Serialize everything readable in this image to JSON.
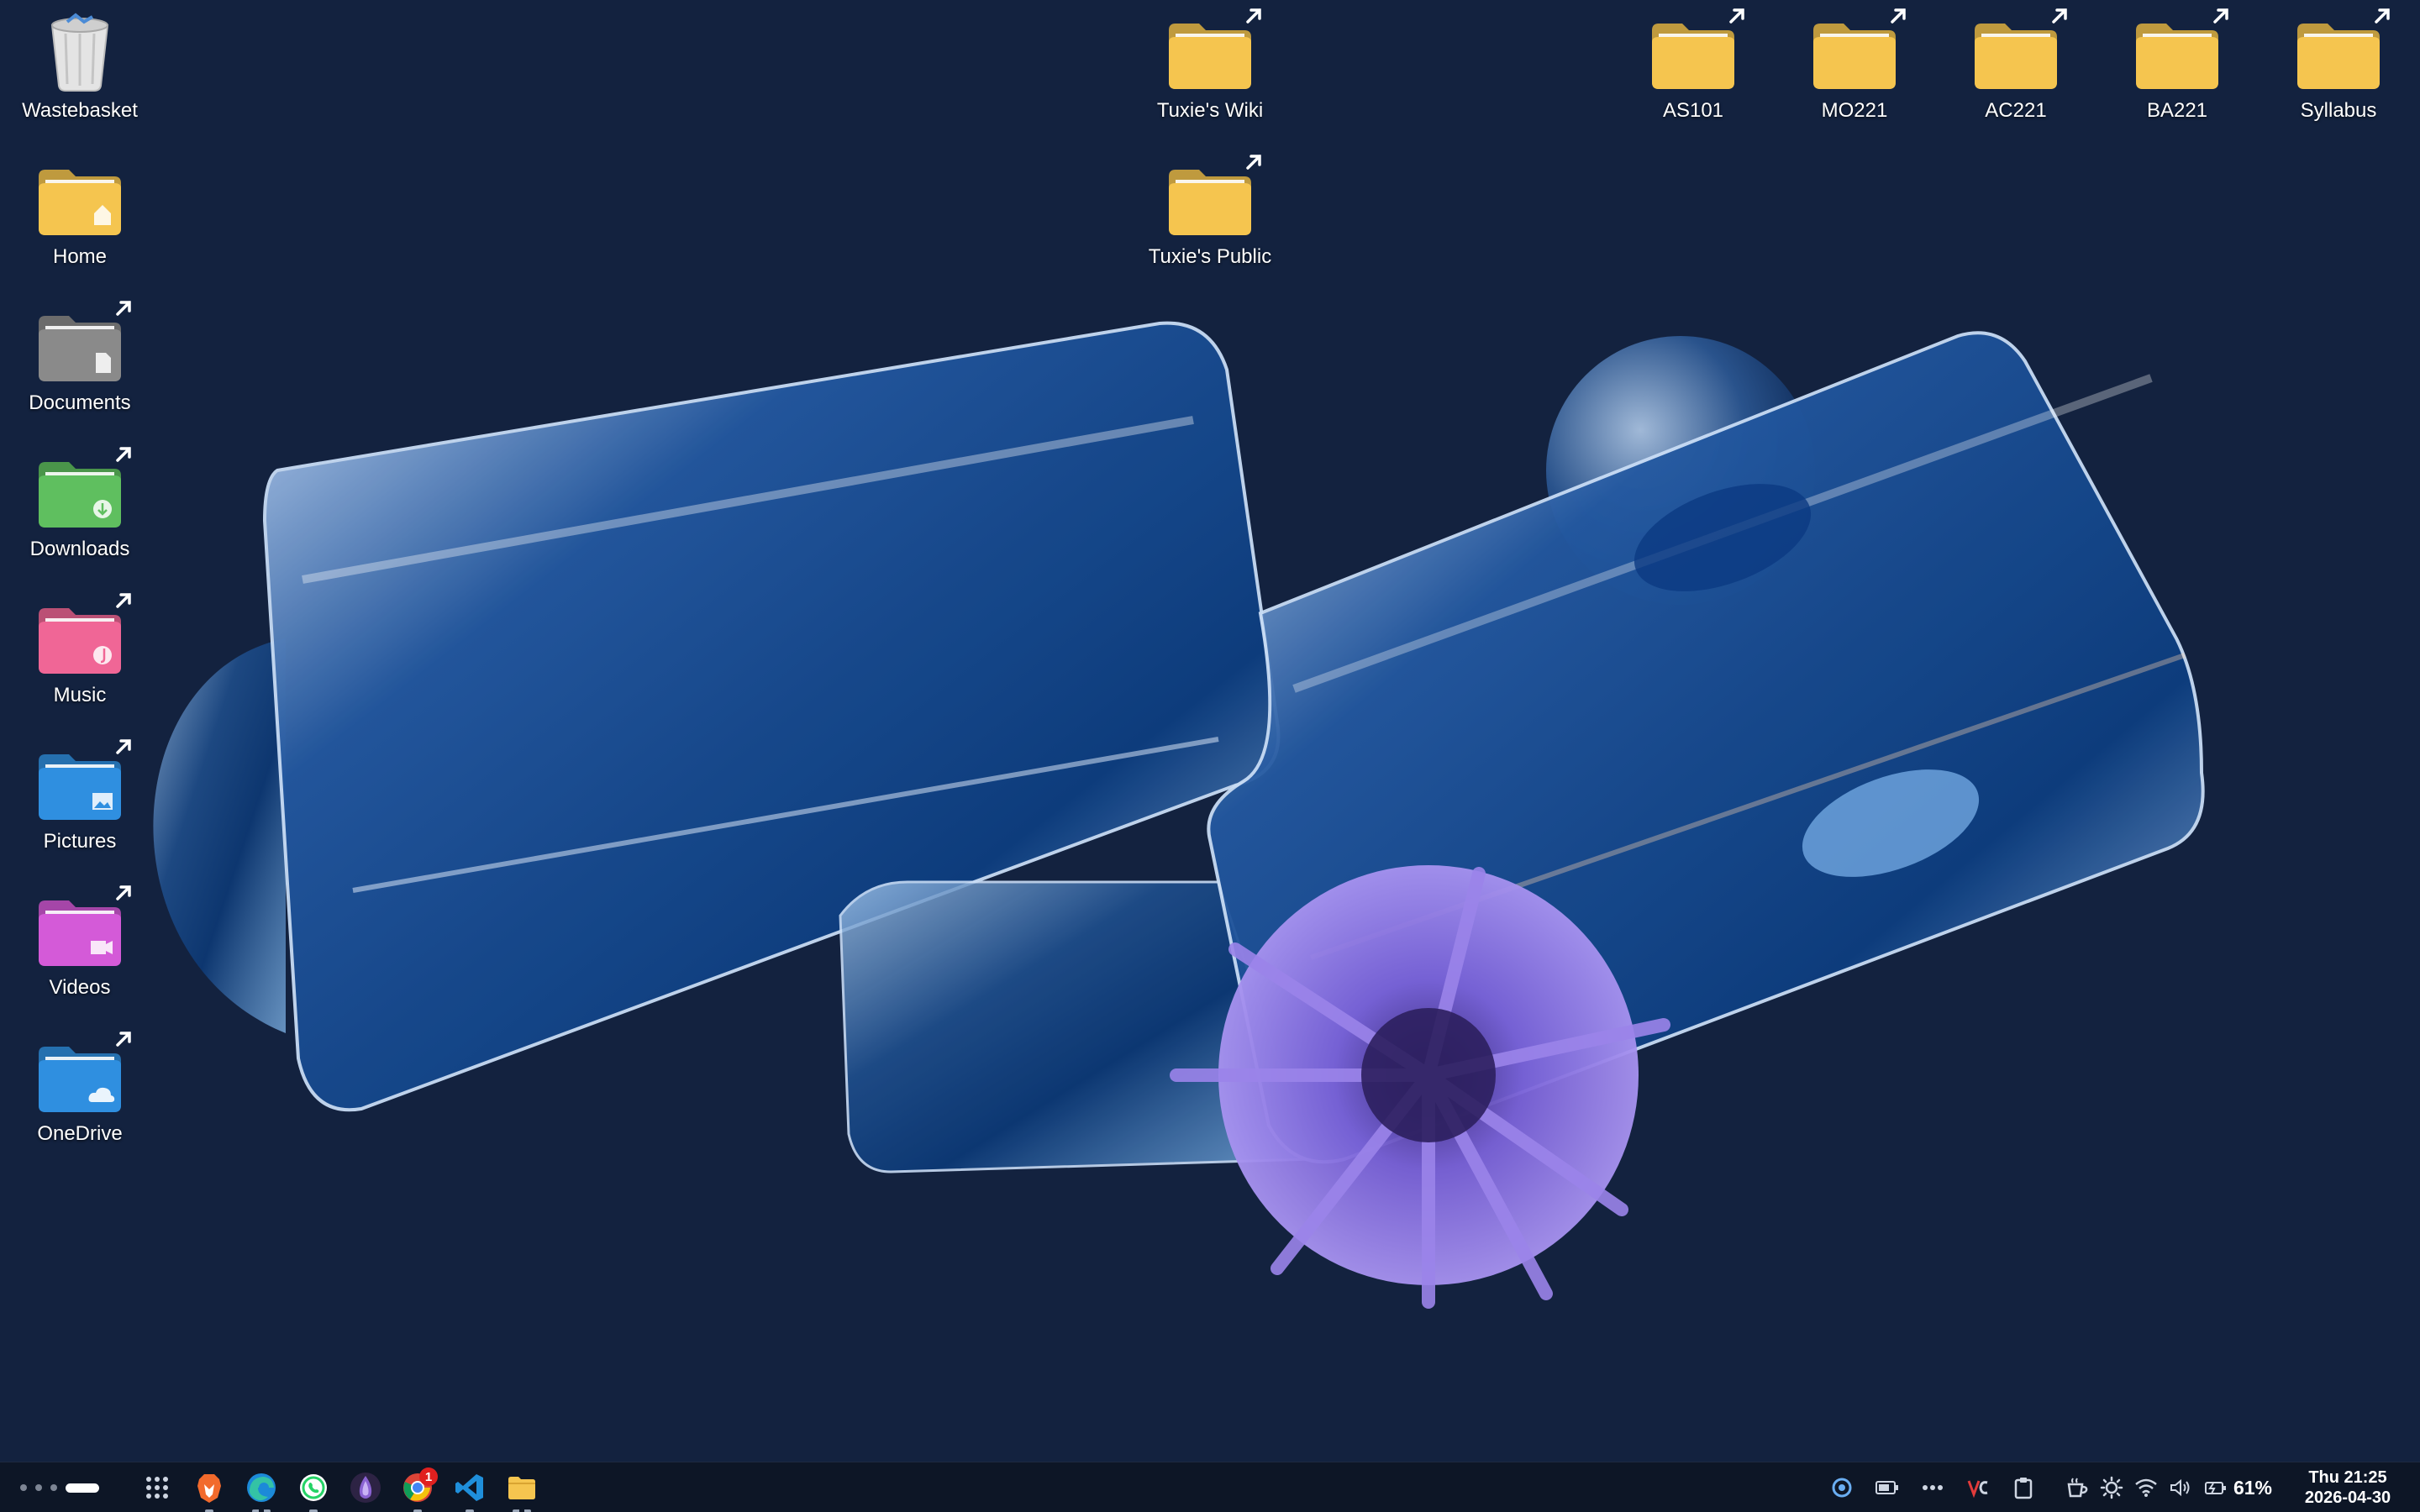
{
  "desktop": {
    "left_column": [
      {
        "label": "Wastebasket",
        "icon": "trash-bin-icon",
        "color": "#d8d8d8",
        "link": false
      },
      {
        "label": "Home",
        "icon": "home-folder-icon",
        "color": "#f5c54f",
        "link": false
      },
      {
        "label": "Documents",
        "icon": "documents-folder-icon",
        "color": "#8a8a8a",
        "link": true
      },
      {
        "label": "Downloads",
        "icon": "downloads-folder-icon",
        "color": "#5fbf5f",
        "link": true
      },
      {
        "label": "Music",
        "icon": "music-folder-icon",
        "color": "#f06696",
        "link": true
      },
      {
        "label": "Pictures",
        "icon": "pictures-folder-icon",
        "color": "#2f8fe0",
        "link": true
      },
      {
        "label": "Videos",
        "icon": "videos-folder-icon",
        "color": "#d45ad8",
        "link": true
      },
      {
        "label": "OneDrive",
        "icon": "onedrive-folder-icon",
        "color": "#2f8fe0",
        "link": true
      }
    ],
    "middle_column": [
      {
        "label": "Tuxie's Wiki",
        "icon": "folder-icon",
        "color": "#f5c54f",
        "link": true
      },
      {
        "label": "Tuxie's Public",
        "icon": "folder-icon",
        "color": "#f5c54f",
        "link": true
      }
    ],
    "top_right_row": [
      {
        "label": "AS101",
        "icon": "folder-icon",
        "color": "#f5c54f",
        "link": true
      },
      {
        "label": "MO221",
        "icon": "folder-icon",
        "color": "#f5c54f",
        "link": true
      },
      {
        "label": "AC221",
        "icon": "folder-icon",
        "color": "#f5c54f",
        "link": true
      },
      {
        "label": "BA221",
        "icon": "folder-icon",
        "color": "#f5c54f",
        "link": true
      },
      {
        "label": "Syllabus",
        "icon": "folder-icon",
        "color": "#f5c54f",
        "link": true
      }
    ]
  },
  "taskbar": {
    "apps": [
      {
        "name": "app-launcher-icon"
      },
      {
        "name": "brave-browser-icon"
      },
      {
        "name": "edge-browser-icon"
      },
      {
        "name": "whatsapp-icon"
      },
      {
        "name": "tor-browser-icon"
      },
      {
        "name": "chrome-browser-icon",
        "badge": "1"
      },
      {
        "name": "vscode-icon"
      },
      {
        "name": "file-manager-icon"
      }
    ],
    "tray": {
      "battery_percent": "61%",
      "time": "Thu 21:25",
      "date": "2026-04-30"
    }
  }
}
